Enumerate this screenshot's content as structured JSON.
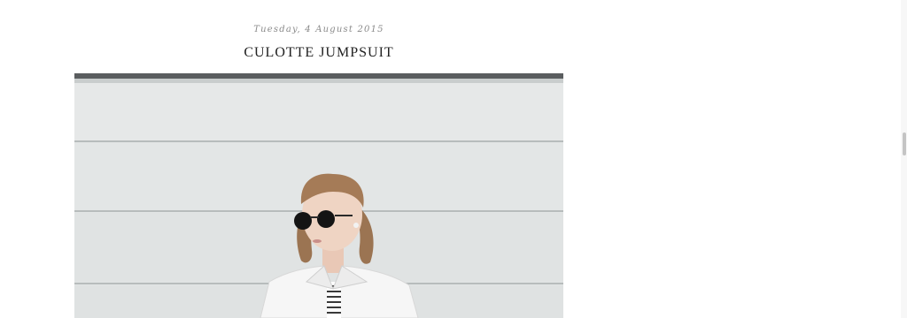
{
  "post": {
    "date": "Tuesday, 4 August 2015",
    "title": "CULOTTE JUMPSUIT"
  },
  "image": {
    "description_name": "post-photo"
  },
  "colors": {
    "wall": "#dfe3e3",
    "groove": "#b9bebe",
    "title": "#222222",
    "date": "#8a8a8a"
  }
}
